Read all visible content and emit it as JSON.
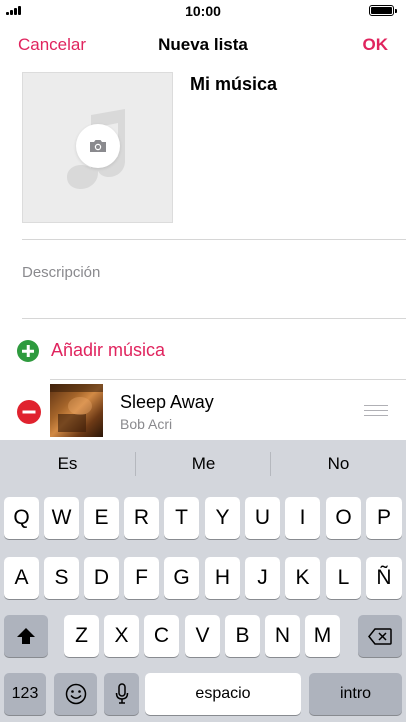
{
  "status": {
    "time": "10:00",
    "battery_level": 1.0
  },
  "nav": {
    "cancel": "Cancelar",
    "title": "Nueva lista",
    "ok": "OK"
  },
  "playlist": {
    "name": "Mi música",
    "description_placeholder": "Descripción",
    "add_music": "Añadir música",
    "songs": [
      {
        "title": "Sleep Away",
        "artist": "Bob Acri"
      }
    ]
  },
  "keyboard": {
    "suggestions": [
      "Es",
      "Me",
      "No"
    ],
    "row1": [
      "Q",
      "W",
      "E",
      "R",
      "T",
      "Y",
      "U",
      "I",
      "O",
      "P"
    ],
    "row2": [
      "A",
      "S",
      "D",
      "F",
      "G",
      "H",
      "J",
      "K",
      "L",
      "Ñ"
    ],
    "row3": [
      "Z",
      "X",
      "C",
      "V",
      "B",
      "N",
      "M"
    ],
    "numbers": "123",
    "space": "espacio",
    "return": "intro"
  },
  "colors": {
    "accent": "#e0245e",
    "add": "#2e9a3e",
    "delete": "#e0222e",
    "keyboard_bg": "#d3d6dc"
  },
  "icons": [
    "camera-icon",
    "music-note-icon",
    "plus-circle-icon",
    "minus-circle-icon",
    "reorder-icon",
    "shift-icon",
    "backspace-icon",
    "emoji-icon",
    "microphone-icon"
  ]
}
